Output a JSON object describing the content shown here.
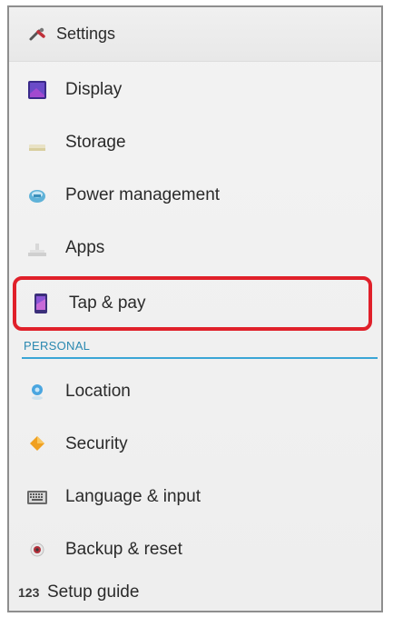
{
  "header": {
    "title": "Settings",
    "icon": "settings-icon"
  },
  "items_top": [
    {
      "label": "Display",
      "icon": "display-icon"
    },
    {
      "label": "Storage",
      "icon": "storage-icon"
    },
    {
      "label": "Power management",
      "icon": "battery-icon"
    },
    {
      "label": "Apps",
      "icon": "apps-icon"
    },
    {
      "label": "Tap & pay",
      "icon": "tap-pay-icon",
      "highlighted": true
    }
  ],
  "section": {
    "label": "PERSONAL"
  },
  "items_personal": [
    {
      "label": "Location",
      "icon": "location-icon"
    },
    {
      "label": "Security",
      "icon": "security-icon"
    },
    {
      "label": "Language & input",
      "icon": "keyboard-icon"
    },
    {
      "label": "Backup & reset",
      "icon": "backup-icon"
    },
    {
      "label": "Setup guide",
      "icon": "setup-guide-icon",
      "icon_text": "123"
    }
  ],
  "colors": {
    "highlight": "#e0202a",
    "section_accent": "#3aa5d6"
  }
}
